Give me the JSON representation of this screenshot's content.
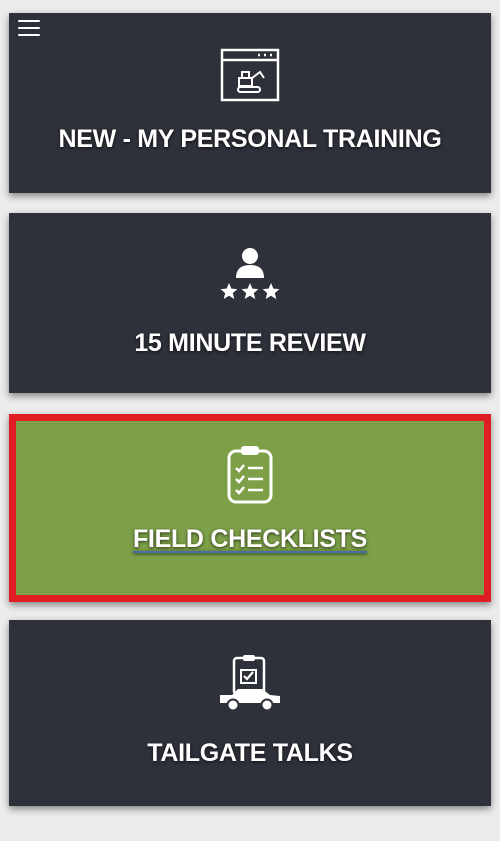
{
  "header": {
    "menu_icon": "hamburger-menu-icon"
  },
  "cards": [
    {
      "label": "NEW - MY PERSONAL TRAINING",
      "icon": "construction-training-icon",
      "background": "#2e303a"
    },
    {
      "label": "15 MINUTE REVIEW",
      "icon": "person-rating-stars-icon",
      "background": "#2e303a"
    },
    {
      "label": "FIELD CHECKLISTS",
      "icon": "clipboard-checklist-icon",
      "background": "#7c9f48",
      "selected": true,
      "highlight_border": "#e01d22"
    },
    {
      "label": "TAILGATE TALKS",
      "icon": "truck-clipboard-icon",
      "background": "#2e303a"
    }
  ]
}
